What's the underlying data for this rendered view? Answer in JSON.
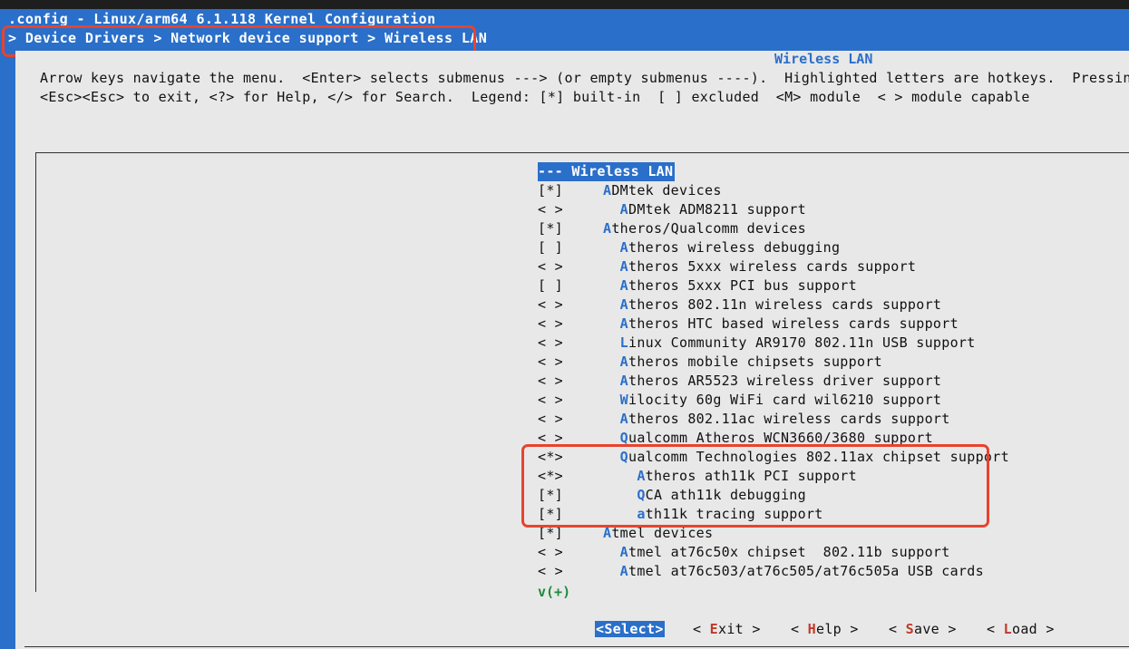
{
  "window": {
    "title": ".config - Linux/arm64 6.1.118 Kernel Configuration",
    "breadcrumb": "> Device Drivers > Network device support > Wireless LAN"
  },
  "dialog": {
    "title": "Wireless LAN",
    "help_line1": "Arrow keys navigate the menu.  <Enter> selects submenus ---> (or empty submenus ----).  Highlighted letters are hotkeys.  Pressing <Y>",
    "help_line2": "<Esc><Esc> to exit, <?> for Help, </> for Search.  Legend: [*] built-in  [ ] excluded  <M> module  < > module capable"
  },
  "menu": {
    "selected": {
      "state": "---",
      "label": "Wireless LAN"
    },
    "items": [
      {
        "state": "[*]",
        "indent": "",
        "hotkey": "A",
        "rest": "DMtek devices"
      },
      {
        "state": "< >",
        "indent": "  ",
        "hotkey": "A",
        "rest": "DMtek ADM8211 support"
      },
      {
        "state": "[*]",
        "indent": "",
        "hotkey": "A",
        "rest": "theros/Qualcomm devices"
      },
      {
        "state": "[ ]",
        "indent": "  ",
        "hotkey": "A",
        "rest": "theros wireless debugging"
      },
      {
        "state": "< >",
        "indent": "  ",
        "hotkey": "A",
        "rest": "theros 5xxx wireless cards support"
      },
      {
        "state": "[ ]",
        "indent": "  ",
        "hotkey": "A",
        "rest": "theros 5xxx PCI bus support"
      },
      {
        "state": "< >",
        "indent": "  ",
        "hotkey": "A",
        "rest": "theros 802.11n wireless cards support"
      },
      {
        "state": "< >",
        "indent": "  ",
        "hotkey": "A",
        "rest": "theros HTC based wireless cards support"
      },
      {
        "state": "< >",
        "indent": "  ",
        "hotkey": "L",
        "rest": "inux Community AR9170 802.11n USB support"
      },
      {
        "state": "< >",
        "indent": "  ",
        "hotkey": "A",
        "rest": "theros mobile chipsets support"
      },
      {
        "state": "< >",
        "indent": "  ",
        "hotkey": "A",
        "rest": "theros AR5523 wireless driver support"
      },
      {
        "state": "< >",
        "indent": "  ",
        "hotkey": "W",
        "rest": "ilocity 60g WiFi card wil6210 support"
      },
      {
        "state": "< >",
        "indent": "  ",
        "hotkey": "A",
        "rest": "theros 802.11ac wireless cards support"
      },
      {
        "state": "< >",
        "indent": "  ",
        "hotkey": "Q",
        "rest": "ualcomm Atheros WCN3660/3680 support"
      },
      {
        "state": "<*>",
        "indent": "  ",
        "hotkey": "Q",
        "rest": "ualcomm Technologies 802.11ax chipset support"
      },
      {
        "state": "<*>",
        "indent": "    ",
        "hotkey": "A",
        "rest": "theros ath11k PCI support"
      },
      {
        "state": "[*]",
        "indent": "    ",
        "hotkey": "Q",
        "rest": "CA ath11k debugging"
      },
      {
        "state": "[*]",
        "indent": "    ",
        "hotkey": "a",
        "rest": "th11k tracing support"
      },
      {
        "state": "[*]",
        "indent": "",
        "hotkey": "A",
        "rest": "tmel devices"
      },
      {
        "state": "< >",
        "indent": "  ",
        "hotkey": "A",
        "rest": "tmel at76c50x chipset  802.11b support"
      },
      {
        "state": "< >",
        "indent": "  ",
        "hotkey": "A",
        "rest": "tmel at76c503/at76c505/at76c505a USB cards"
      }
    ],
    "more_indicator": "v(+)"
  },
  "buttons": {
    "select": "<Select>",
    "exit": {
      "pre": "< ",
      "hotkey": "E",
      "rest": "xit",
      "post": " >"
    },
    "help": {
      "pre": "< ",
      "hotkey": "H",
      "rest": "elp",
      "post": " >"
    },
    "save": {
      "pre": "< ",
      "hotkey": "S",
      "rest": "ave",
      "post": " >"
    },
    "load": {
      "pre": "< ",
      "hotkey": "L",
      "rest": "oad",
      "post": " >"
    }
  },
  "colors": {
    "background": "#2a6fc9",
    "dialog": "#e8e8e8",
    "annotation_outline": "#e8432e"
  }
}
